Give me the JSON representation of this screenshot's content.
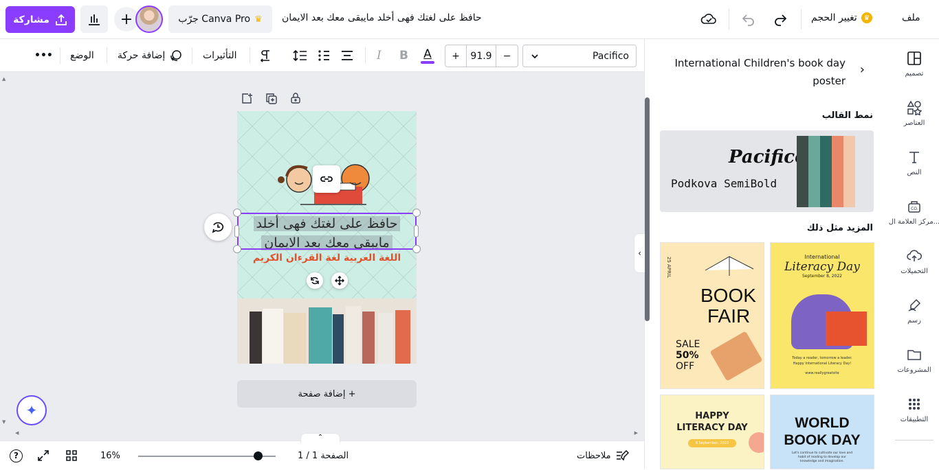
{
  "topbar": {
    "share_label": "مشاركة",
    "pro_label": "جرّب Canva Pro",
    "doc_title": "حافظ على لغتك فهى أخلد مايبقى معك بعد الايمان",
    "resize_label": "تغيير الحجم",
    "file_label": "ملف"
  },
  "toolbar": {
    "font_name": "Pacifico",
    "font_size": "91.9",
    "minus": "−",
    "plus": "+",
    "bold": "B",
    "italic": "I",
    "color_letter": "A",
    "effects_label": "التأثيرات",
    "animate_label": "إضافة حركة",
    "position_label": "الوضع",
    "more": "•••"
  },
  "canvas": {
    "main_line1": "حافظ على لغتك فهى أخلد",
    "main_line2": "مايبقى معك بعد الايمان",
    "sub_text": "اللغة العربية لغة القرءان الكريم",
    "add_page_label": "+ إضافة صفحة"
  },
  "footer": {
    "notes_label": "ملاحظات",
    "page_label": "الصفحة 1 / 1",
    "zoom_label": "16%",
    "zoom_value": 0.87,
    "help": "?"
  },
  "panel": {
    "title": "International Children's book day poster",
    "template_style_label": "نمط القالب",
    "font_primary": "Pacifico",
    "font_secondary": "Podkova SemiBold",
    "palette": [
      "#3e4d47",
      "#6aa89a",
      "#2f6b63",
      "#e8876a",
      "#f2c7aa"
    ],
    "more_like_label": "المزيد مثل ذلك",
    "thumbnails": [
      {
        "lines": [
          "BOOK",
          "FAIR"
        ],
        "extra": [
          "SALE",
          "50%",
          "OFF"
        ],
        "side": "25 APRIL"
      },
      {
        "lines": [
          "International",
          "Literacy Day",
          "September 8, 2022"
        ],
        "extra": [
          "Today a reader, tomorrow a leader.",
          "Happy International Literacy Day!",
          "www.reallygreatsite"
        ]
      },
      {
        "lines": [
          "HAPPY",
          "LITERACY DAY"
        ],
        "extra": [
          "8 September, 2022"
        ]
      },
      {
        "lines": [
          "WORLD",
          "BOOK DAY"
        ],
        "extra": [
          "Let's continue to cultivate our love and habit of reading to develop our knowledge and imagination."
        ]
      }
    ]
  },
  "rail": {
    "items": [
      {
        "label": "تصميم",
        "icon": "layout-icon"
      },
      {
        "label": "العناصر",
        "icon": "shapes-icon"
      },
      {
        "label": "النص",
        "icon": "text-icon"
      },
      {
        "label": "مركز العلامة ال...",
        "icon": "brand-icon"
      },
      {
        "label": "التحميلات",
        "icon": "upload-icon"
      },
      {
        "label": "رسم",
        "icon": "draw-icon"
      },
      {
        "label": "المشروعات",
        "icon": "folder-icon"
      },
      {
        "label": "التطبيقات",
        "icon": "apps-icon"
      }
    ]
  },
  "colors": {
    "accent": "#8b3dff",
    "subtext": "#e0522e",
    "text_color_bar": "#8b3dff"
  }
}
